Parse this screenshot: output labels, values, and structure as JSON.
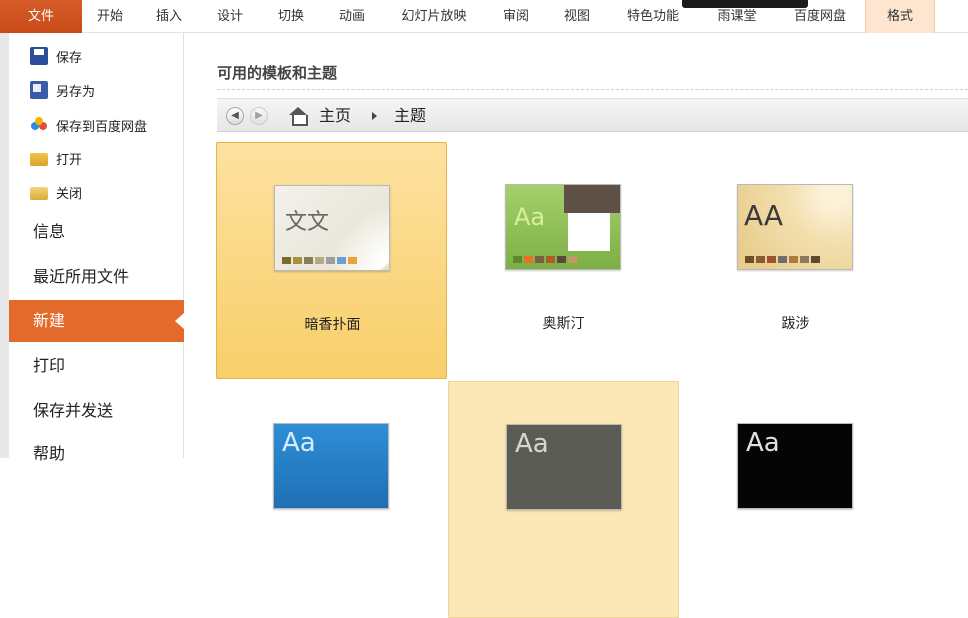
{
  "ribbon": {
    "tabs": [
      "文件",
      "开始",
      "插入",
      "设计",
      "切换",
      "动画",
      "幻灯片放映",
      "审阅",
      "视图",
      "特色功能",
      "雨课堂",
      "百度网盘",
      "格式"
    ]
  },
  "sidebar": {
    "commands": [
      {
        "label": "保存",
        "icon": "save-icon"
      },
      {
        "label": "另存为",
        "icon": "save-as-icon"
      },
      {
        "label": "保存到百度网盘",
        "icon": "baidu-cloud-icon"
      },
      {
        "label": "打开",
        "icon": "open-folder-icon"
      },
      {
        "label": "关闭",
        "icon": "close-folder-icon"
      }
    ],
    "items": [
      "信息",
      "最近所用文件",
      "新建",
      "打印",
      "保存并发送",
      "帮助"
    ],
    "active_item": "新建"
  },
  "main": {
    "section_title": "可用的模板和主题",
    "breadcrumb": {
      "home": "主页",
      "current": "主题"
    },
    "themes": [
      {
        "name": "暗香扑面",
        "sample_text": "文文",
        "selected": true
      },
      {
        "name": "奥斯汀",
        "sample_text": "Aa",
        "selected": false
      },
      {
        "name": "跋涉",
        "sample_text": "AA",
        "selected": false
      },
      {
        "name": "",
        "sample_text": "Aa",
        "selected": false
      },
      {
        "name": "",
        "sample_text": "Aa",
        "selected": false
      },
      {
        "name": "",
        "sample_text": "Aa",
        "selected": false
      }
    ]
  },
  "colors": {
    "accent": "#e46a2b",
    "file_tab": "#d0561f",
    "selected_tile": "#f9d27a"
  }
}
